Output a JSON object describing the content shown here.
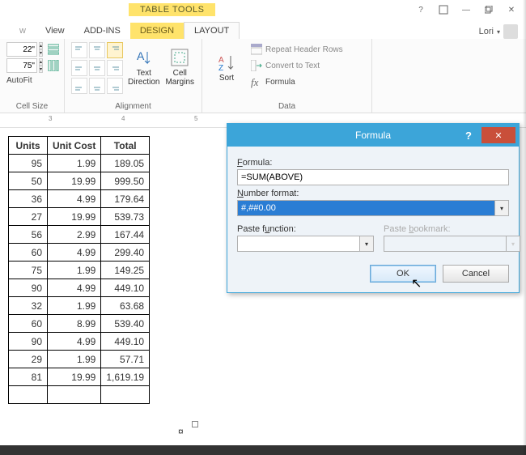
{
  "title_tab": "TABLE TOOLS",
  "tabs": {
    "view": "View",
    "addins": "ADD-INS",
    "design": "DESIGN",
    "layout": "LAYOUT"
  },
  "user": "Lori",
  "ribbon": {
    "size": {
      "h": "22\"",
      "w": "75\"",
      "autofit": "AutoFit",
      "group": "Cell Size"
    },
    "alignment": {
      "text_dir": "Text\nDirection",
      "cell_margins": "Cell\nMargins",
      "group": "Alignment"
    },
    "data": {
      "sort": "Sort",
      "repeat": "Repeat Header Rows",
      "convert": "Convert to Text",
      "formula": "Formula",
      "group": "Data"
    }
  },
  "ruler_marks": [
    "3",
    "4",
    "5"
  ],
  "table": {
    "headers": [
      "Units",
      "Unit Cost",
      "Total"
    ],
    "rows": [
      [
        "95",
        "1.99",
        "189.05"
      ],
      [
        "50",
        "19.99",
        "999.50"
      ],
      [
        "36",
        "4.99",
        "179.64"
      ],
      [
        "27",
        "19.99",
        "539.73"
      ],
      [
        "56",
        "2.99",
        "167.44"
      ],
      [
        "60",
        "4.99",
        "299.40"
      ],
      [
        "75",
        "1.99",
        "149.25"
      ],
      [
        "90",
        "4.99",
        "449.10"
      ],
      [
        "32",
        "1.99",
        "63.68"
      ],
      [
        "60",
        "8.99",
        "539.40"
      ],
      [
        "90",
        "4.99",
        "449.10"
      ],
      [
        "29",
        "1.99",
        "57.71"
      ],
      [
        "81",
        "19.99",
        "1,619.19"
      ],
      [
        "",
        "",
        ""
      ]
    ]
  },
  "dialog": {
    "title": "Formula",
    "formula_label": "Formula:",
    "formula_value": "=SUM(ABOVE)",
    "numfmt_label": "Number format:",
    "numfmt_value": "#,##0.00",
    "pastefn_label": "Paste function:",
    "pastebm_label": "Paste bookmark:",
    "ok": "OK",
    "cancel": "Cancel"
  }
}
